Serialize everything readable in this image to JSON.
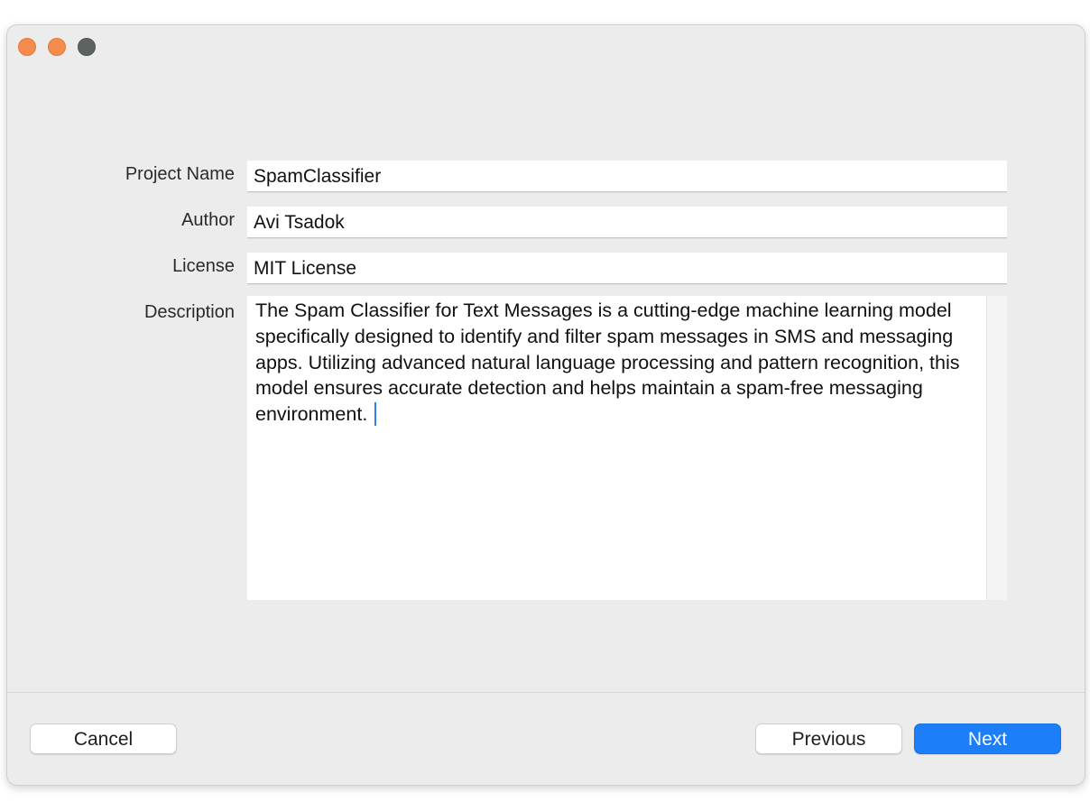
{
  "window": {
    "traffic_lights": {
      "close_color": "#f58c4b",
      "minimize_color": "#f58c4b",
      "zoom_color": "#5e6360"
    }
  },
  "form": {
    "project_name": {
      "label": "Project Name",
      "value": "SpamClassifier"
    },
    "author": {
      "label": "Author",
      "value": "Avi Tsadok"
    },
    "license": {
      "label": "License",
      "value": "MIT License"
    },
    "description": {
      "label": "Description",
      "value": "The Spam Classifier for Text Messages is a cutting-edge machine learning model specifically designed to identify and filter spam messages in SMS and messaging apps. Utilizing advanced natural language processing and pattern recognition, this model ensures accurate detection and helps maintain a spam-free messaging environment."
    }
  },
  "footer": {
    "cancel_label": "Cancel",
    "previous_label": "Previous",
    "next_label": "Next",
    "accent_color": "#1c7ef8"
  }
}
